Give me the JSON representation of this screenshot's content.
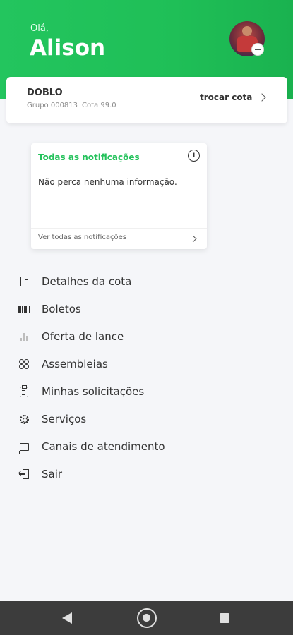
{
  "header": {
    "greeting": "Olá,",
    "name": "Alison"
  },
  "quota": {
    "title": "DOBLO",
    "group": "Grupo 000813",
    "cota": "Cota 99.0",
    "switch_label": "trocar cota"
  },
  "notifications": {
    "title": "Todas as notificações",
    "info_icon": "i",
    "body": "Não perca nenhuma informação.",
    "link": "Ver todas as notificações"
  },
  "menu": {
    "items": [
      {
        "label": "Detalhes da cota",
        "icon": "document-icon"
      },
      {
        "label": "Boletos",
        "icon": "barcode-icon"
      },
      {
        "label": "Oferta de lance",
        "icon": "bar-chart-icon"
      },
      {
        "label": "Assembleias",
        "icon": "clover-icon"
      },
      {
        "label": "Minhas solicitações",
        "icon": "clipboard-icon"
      },
      {
        "label": "Serviços",
        "icon": "gear-icon"
      },
      {
        "label": "Canais de atendimento",
        "icon": "chat-icon"
      },
      {
        "label": "Sair",
        "icon": "exit-icon"
      }
    ]
  },
  "colors": {
    "brand_green": "#25c25c",
    "background": "#f5f6f9",
    "navbar": "#3c3c3c"
  }
}
